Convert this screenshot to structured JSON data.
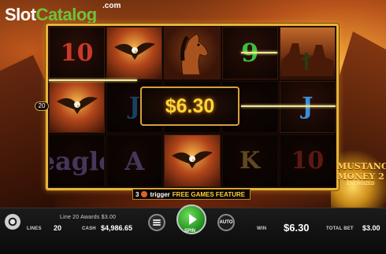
{
  "branding": {
    "site_a": "Slot",
    "site_b": "Catalog",
    "site_tld": ".com"
  },
  "game_logo": {
    "line1": "MUSTANG",
    "line2": "MONEY 2",
    "line3": "ENERGIZED"
  },
  "reels": [
    [
      "10",
      "A",
      "eagle"
    ],
    [
      "eagle",
      "J",
      "A"
    ],
    [
      "mustang",
      "",
      "eagle"
    ],
    [
      "9",
      "",
      "K"
    ],
    [
      "canyon",
      "J",
      "10"
    ]
  ],
  "win_display": "$6.30",
  "line_marker": "20",
  "feature": {
    "count": "3",
    "trigger": "trigger",
    "label": "FREE GAMES FEATURE"
  },
  "bottom": {
    "line_awards": "Line 20 Awards $3.00",
    "lines_label": "LINES",
    "lines_value": "20",
    "cash_label": "CASH",
    "cash_value": "$4,986.65",
    "spin_label": "SPIN",
    "auto_label": "AUTO",
    "win_label": "WIN",
    "win_value": "$6.30",
    "total_bet_label": "TOTAL BET",
    "total_bet_value": "$3.00"
  }
}
